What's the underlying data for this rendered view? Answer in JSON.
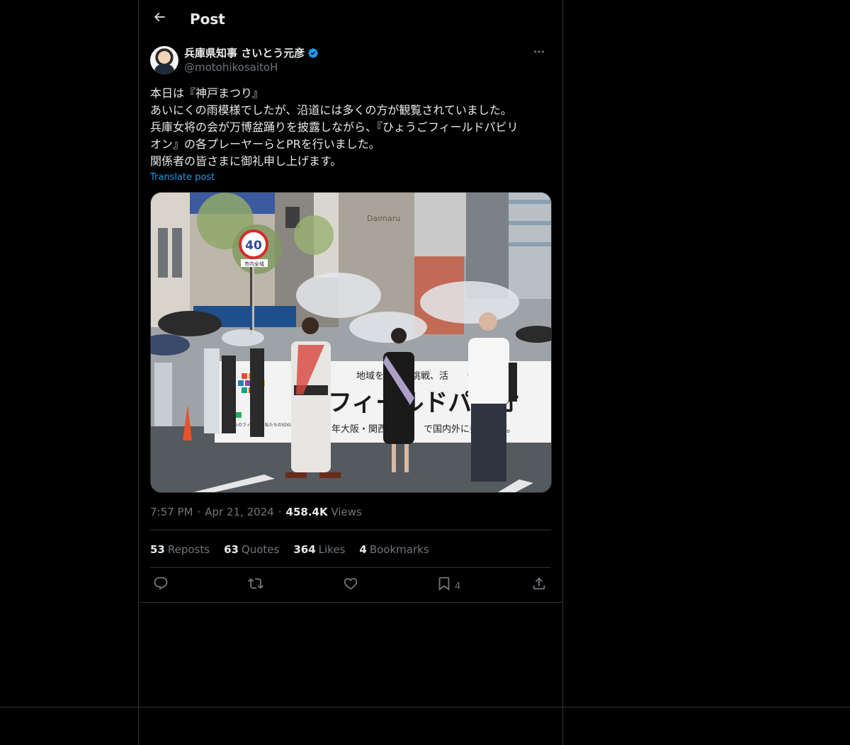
{
  "header": {
    "title": "Post"
  },
  "author": {
    "display_name": "兵庫県知事 さいとう元彦",
    "handle": "@motohikosaitoH",
    "verified": true,
    "verified_color": "#1d9bf0"
  },
  "tweet": {
    "lines": [
      "本日は『神戸まつり』",
      "あいにくの雨模様でしたが、沿道には多くの方が観覧されていました。",
      "兵庫女将の会が万博盆踊りを披露しながら、『ひょうごフィールドパビリ",
      "オン』の各プレーヤーらとPRを行いました。",
      "関係者の皆さまに御礼申し上げます。"
    ],
    "translate_label": "Translate post"
  },
  "photo": {
    "speed_sign": "40",
    "speed_sign_sub": "市内全域",
    "banner_text_top": "地域を　　る挑戦、活　　もの",
    "banner_text_main": "フィールドパ　オ",
    "banner_text_bottom": "年大阪・関西万　　　で国内外に発　　　。",
    "banner_logo_caption": "私たちのフィールド 私たちのSDGs",
    "shop_sign": "Daimaru"
  },
  "meta": {
    "time": "7:57 PM",
    "date": "Apr 21, 2024",
    "views_count": "458.4K",
    "views_label": "Views"
  },
  "stats": [
    {
      "count": "53",
      "label": "Reposts"
    },
    {
      "count": "63",
      "label": "Quotes"
    },
    {
      "count": "364",
      "label": "Likes"
    },
    {
      "count": "4",
      "label": "Bookmarks"
    }
  ],
  "actions": {
    "bookmark_count": "4"
  },
  "icons": {
    "back": "arrow-left-icon",
    "more": "more-horizontal-icon",
    "reply": "reply-icon",
    "repost": "repost-icon",
    "like": "heart-icon",
    "bookmark": "bookmark-icon",
    "share": "share-icon",
    "verified": "verified-badge-icon"
  },
  "colors": {
    "background": "#000000",
    "text": "#e7e9ea",
    "secondary_text": "#71767b",
    "border": "#2f3336",
    "link": "#1d9bf0"
  }
}
